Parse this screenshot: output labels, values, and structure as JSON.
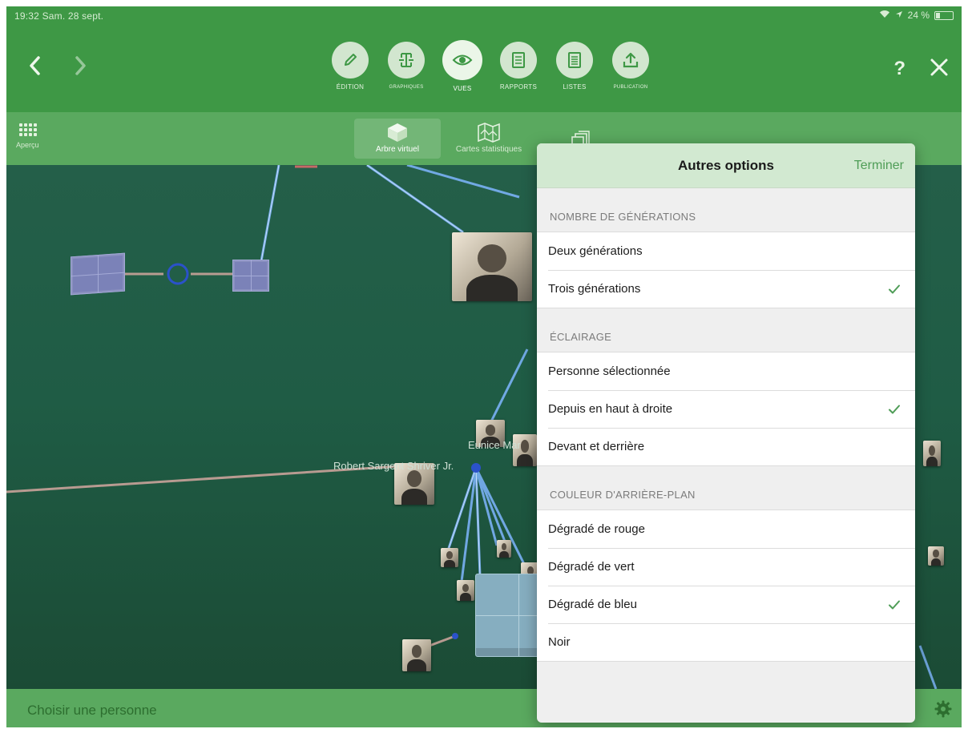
{
  "status_bar": {
    "time": "19:32  Sam. 28 sept.",
    "battery": "24 %"
  },
  "toolbar": {
    "modes": [
      {
        "label": "ÉDITION",
        "icon": "pencil-icon"
      },
      {
        "label": "GRAPHIQUES",
        "icon": "chart-icon"
      },
      {
        "label": "VUES",
        "icon": "eye-icon"
      },
      {
        "label": "RAPPORTS",
        "icon": "document-icon"
      },
      {
        "label": "LISTES",
        "icon": "list-icon"
      },
      {
        "label": "PUBLICATION",
        "icon": "upload-icon"
      }
    ],
    "help_label": "?"
  },
  "subbar": {
    "apercu_label": "Aperçu",
    "tabs": [
      {
        "label": "Arbre virtuel",
        "icon": "cube-icon",
        "selected": true
      },
      {
        "label": "Cartes statistiques",
        "icon": "map-icon",
        "selected": false
      },
      {
        "label": "",
        "icon": "copies-icon",
        "selected": false
      }
    ]
  },
  "scene": {
    "labels": [
      "Robert Sargent Shriver Jr.",
      "Eunice Mar"
    ]
  },
  "bottom_bar": {
    "choose_label": "Choisir une personne"
  },
  "popover": {
    "title": "Autres options",
    "done_label": "Terminer",
    "sections": [
      {
        "header": "NOMBRE DE GÉNÉRATIONS",
        "options": [
          {
            "label": "Deux générations",
            "checked": false
          },
          {
            "label": "Trois générations",
            "checked": true
          }
        ]
      },
      {
        "header": "ÉCLAIRAGE",
        "options": [
          {
            "label": "Personne sélectionnée",
            "checked": false
          },
          {
            "label": "Depuis en haut à droite",
            "checked": true
          },
          {
            "label": "Devant et derrière",
            "checked": false
          }
        ]
      },
      {
        "header": "COULEUR D'ARRIÈRE-PLAN",
        "options": [
          {
            "label": "Dégradé de rouge",
            "checked": false
          },
          {
            "label": "Dégradé de vert",
            "checked": false
          },
          {
            "label": "Dégradé de bleu",
            "checked": true
          },
          {
            "label": "Noir",
            "checked": false
          }
        ]
      }
    ]
  },
  "colors": {
    "toolbar": "#3e9845",
    "subbar": "#5aa95f",
    "accent_check": "#4f9d57",
    "popover_header": "#d2e9d1"
  }
}
